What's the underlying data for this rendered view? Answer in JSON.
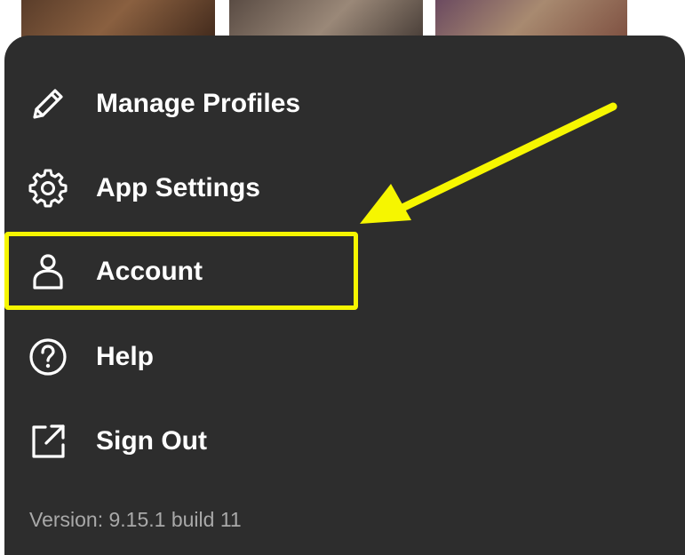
{
  "menu": {
    "items": [
      {
        "label": "Manage Profiles",
        "icon": "pencil-icon"
      },
      {
        "label": "App Settings",
        "icon": "gear-icon"
      },
      {
        "label": "Account",
        "icon": "person-icon"
      },
      {
        "label": "Help",
        "icon": "help-circle-icon"
      },
      {
        "label": "Sign Out",
        "icon": "external-link-icon"
      }
    ]
  },
  "version": "Version: 9.15.1 build 11",
  "annotation": {
    "highlighted_item": "Account",
    "color": "#f6f600"
  },
  "colors": {
    "sheet_background": "#2d2d2d",
    "text": "#ffffff",
    "version_text": "#a9a9a9"
  }
}
